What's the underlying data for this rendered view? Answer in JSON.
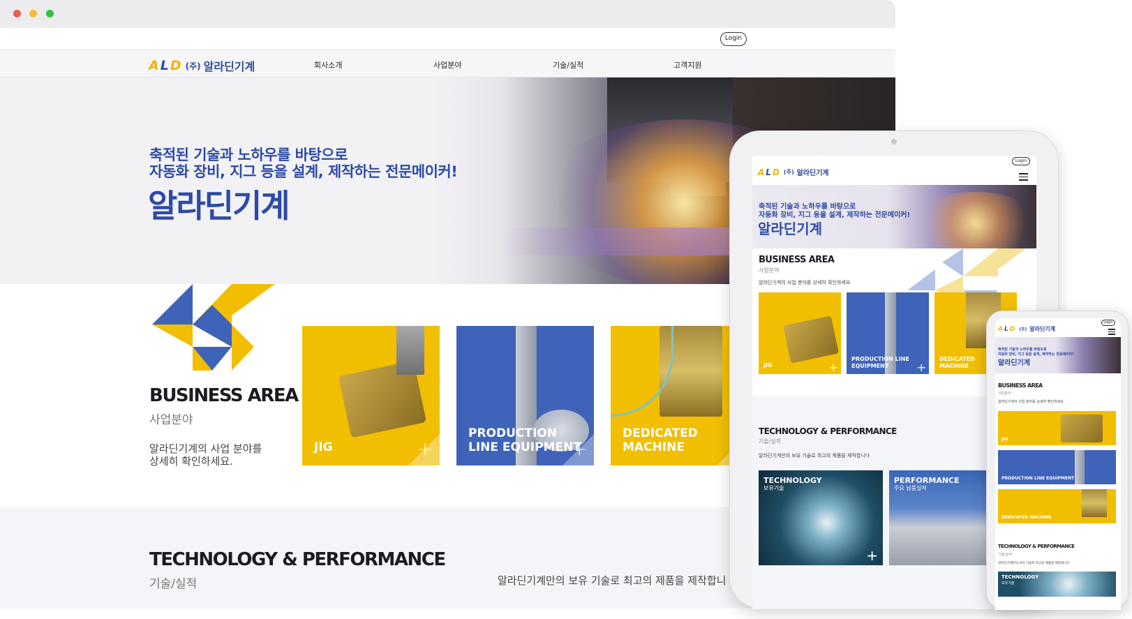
{
  "browser": {
    "login_label": "Login",
    "logo": {
      "mark": "ALD",
      "corp": "(주)",
      "name": "알라딘기계"
    },
    "nav": [
      "회사소개",
      "사업분야",
      "기술/실적",
      "고객지원"
    ],
    "hero": {
      "line1": "축적된 기술과 노하우를 바탕으로",
      "line2": "자동화 장비, 지그 등을 설계, 제작하는 전문메이커!",
      "title": "알라딘기계"
    },
    "business": {
      "title": "BUSINESS AREA",
      "subtitle": "사업분야",
      "desc_line1": "알라딘기계의 사업 분야를",
      "desc_line2": "상세히 확인하세요."
    },
    "cards": [
      {
        "label": "JIG",
        "color": "#f1be00"
      },
      {
        "label_line1": "PRODUCTION",
        "label_line2": "LINE EQUIPMENT",
        "color": "#3e63b8"
      },
      {
        "label_line1": "DEDICATED",
        "label_line2": "MACHINE",
        "color": "#f1be00"
      }
    ],
    "tech": {
      "title": "TECHNOLOGY & PERFORMANCE",
      "subtitle": "기술/실적",
      "desc": "알라딘기계만의 보유 기술로 최고의 제품을 제작합니"
    }
  },
  "tablet": {
    "login_label": "Login",
    "hero_line1": "축적된 기술과 노하우를 바탕으로",
    "hero_line2": "자동화 장비, 지그 등을 설계, 제작하는 전문메이커!",
    "hero_title": "알라딘기계",
    "business_title": "BUSINESS AREA",
    "business_sub": "사업분야",
    "business_desc": "알라딘기계의 사업 분야를 상세히 확인하세요",
    "cards": [
      "JIG",
      "PRODUCTION LINE",
      "EQUIPMENT",
      "DEDICATED",
      "MACHINE"
    ],
    "tech_title": "TECHNOLOGY & PERFORMANCE",
    "tech_sub": "기술/실적",
    "tech_desc": "알라딘기계만의 보유 기술로 최고의 제품을 제작합니다",
    "tech_cards": [
      {
        "title": "TECHNOLOGY",
        "sub": "보유기술"
      },
      {
        "title": "PERFORMANCE",
        "sub": "주요 납품실적"
      }
    ]
  },
  "phone": {
    "login_label": "Login",
    "hero_line1": "축적된 기술과 노하우를 바탕으로",
    "hero_line2": "자동화 장비, 지그 등을 설계, 제작하는 전문메이커!",
    "hero_title": "알라딘기계",
    "business_title": "BUSINESS AREA",
    "business_sub": "사업분야",
    "business_desc": "알라딘기계의 사업 분야를 상세히 확인하세요",
    "cards": [
      "JIG",
      "PRODUCTION LINE EQUIPMENT",
      "DEDICATED MACHINE"
    ],
    "tech_title": "TECHNOLOGY & PERFORMANCE",
    "tech_sub": "기술/실적",
    "tech_desc": "알라딘기계만의 보유 기술로 최고의 제품을 제작합니다",
    "tech_card": {
      "title": "TECHNOLOGY",
      "sub": "보유기술"
    }
  },
  "colors": {
    "brand_blue": "#2d4aa5",
    "brand_yellow": "#f1be00",
    "card_blue": "#3e63b8"
  },
  "icons": [
    "window-close-dot",
    "window-minimize-dot",
    "window-maximize-dot",
    "pinwheel-logo",
    "plus-icon",
    "hamburger-menu-icon"
  ]
}
